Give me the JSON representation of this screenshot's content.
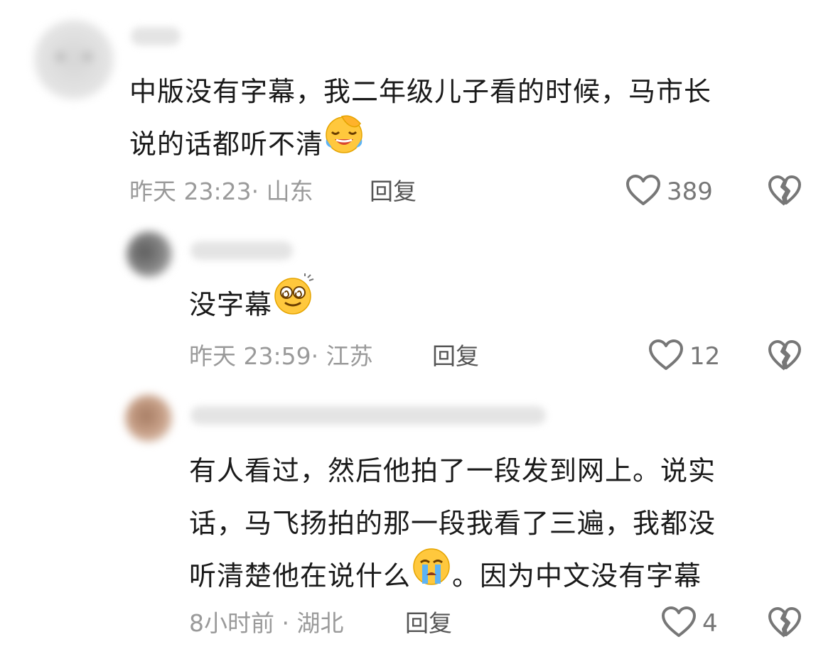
{
  "comments": [
    {
      "text_lines": [
        "中版没有字幕，我二年级儿子看的时候，马市长",
        "说的话都听不清"
      ],
      "emoji": "facepalm-laughing-emoji",
      "time": "昨天 23:23",
      "location": "山东",
      "meta": "昨天 23:23· 山东",
      "reply_label": "回复",
      "likes": "389"
    },
    {
      "text_lines": [
        "没字幕"
      ],
      "emoji": "dizzy-smile-emoji",
      "meta": "昨天 23:59· 江苏",
      "reply_label": "回复",
      "likes": "12"
    },
    {
      "text_lines": [
        "有人看过，然后他拍了一段发到网上。说实",
        "话，马飞扬拍的那一段我看了三遍，我都没",
        "听清楚他在说什么",
        "。因为中文没有字幕"
      ],
      "emoji": "crying-emoji",
      "meta": "8小时前 · 湖北",
      "reply_label": "回复",
      "likes": "4"
    }
  ],
  "icons": {
    "like": "heart-outline-icon",
    "dislike": "broken-heart-icon"
  },
  "colors": {
    "text": "#1a1a1a",
    "meta": "#9a9a9a",
    "icon": "#777777"
  }
}
